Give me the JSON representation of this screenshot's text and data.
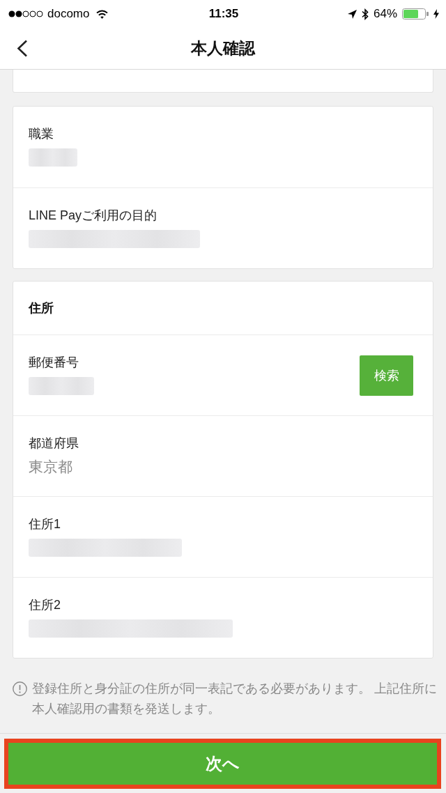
{
  "status_bar": {
    "carrier": "docomo",
    "time": "11:35",
    "battery": "64%"
  },
  "header": {
    "title": "本人確認"
  },
  "cards": [
    {
      "fields": [
        {
          "label": "職業",
          "kind": "blurred"
        },
        {
          "label": "LINE Payご利用の目的",
          "kind": "blurred"
        }
      ]
    },
    {
      "title": "住所",
      "fields": [
        {
          "label": "郵便番号",
          "kind": "blurred",
          "button": "検索"
        },
        {
          "label": "都道府県",
          "kind": "text",
          "value": "東京都"
        },
        {
          "label": "住所1",
          "kind": "blurred"
        },
        {
          "label": "住所2",
          "kind": "blurred"
        }
      ]
    }
  ],
  "note": {
    "text": "登録住所と身分証の住所が同一表記である必要があります。 上記住所に本人確認用の書類を発送します。"
  },
  "next_button": {
    "label": "次へ",
    "highlighted": true
  }
}
